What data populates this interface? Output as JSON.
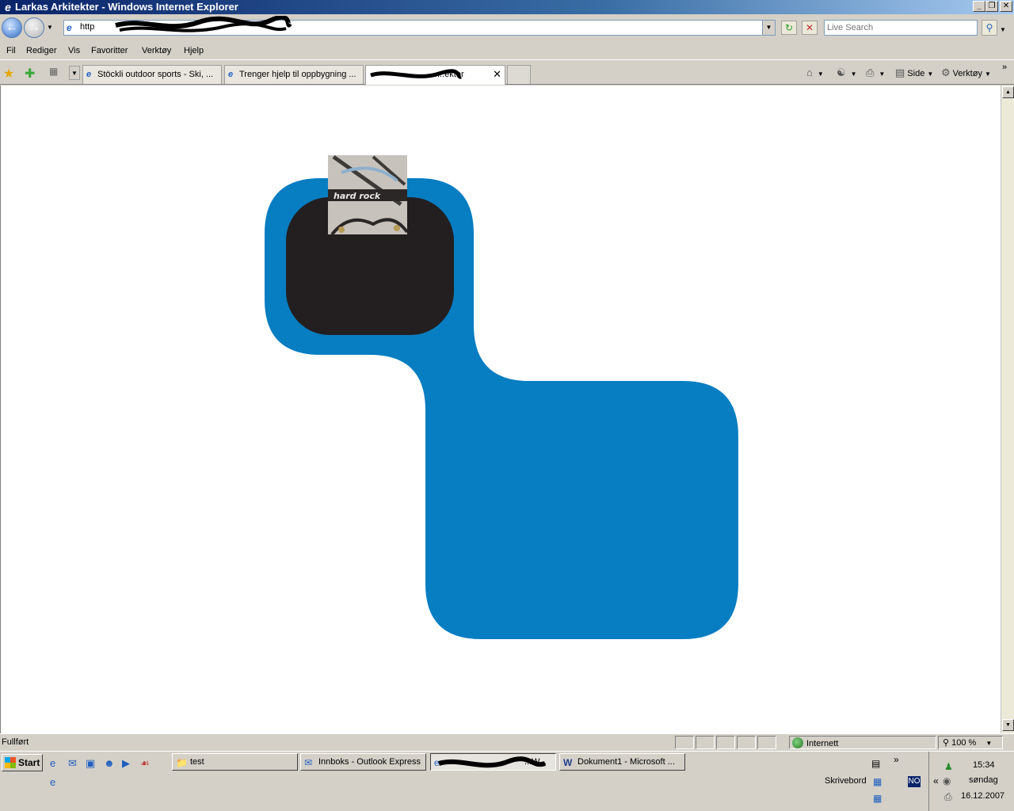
{
  "window": {
    "title": "Larkas Arkitekter - Windows Internet Explorer",
    "minimize_glyph": "_",
    "maximize_glyph": "❐",
    "close_glyph": "✕"
  },
  "address": {
    "url_prefix": "http",
    "search_placeholder": "Live Search"
  },
  "menu": {
    "items": [
      "Fil",
      "Rediger",
      "Vis",
      "Favoritter",
      "Verktøy",
      "Hjelp"
    ]
  },
  "tabs": [
    {
      "label": "Stöckli outdoor sports - Ski, ..."
    },
    {
      "label": "Trenger hjelp til oppbygning ..."
    },
    {
      "label": "...ekter"
    }
  ],
  "commands": {
    "side_label": "Side",
    "tools_label": "Verktøy"
  },
  "page": {
    "image_caption": "hard rock",
    "colors": {
      "accent_blue": "#077dc2",
      "dark_panel": "#231f20"
    }
  },
  "statusbar": {
    "status": "Fullført",
    "zone": "Internett",
    "zoom": "100 %"
  },
  "taskbar": {
    "start_label": "Start",
    "buttons": [
      {
        "label": "test"
      },
      {
        "label": "Innboks - Outlook Express"
      },
      {
        "label": "...W..."
      },
      {
        "label": "Dokument1 - Microsoft ..."
      }
    ],
    "desktop_label": "Skrivebord",
    "language": "NO",
    "time": "15:34",
    "day": "søndag",
    "date": "16.12.2007"
  }
}
